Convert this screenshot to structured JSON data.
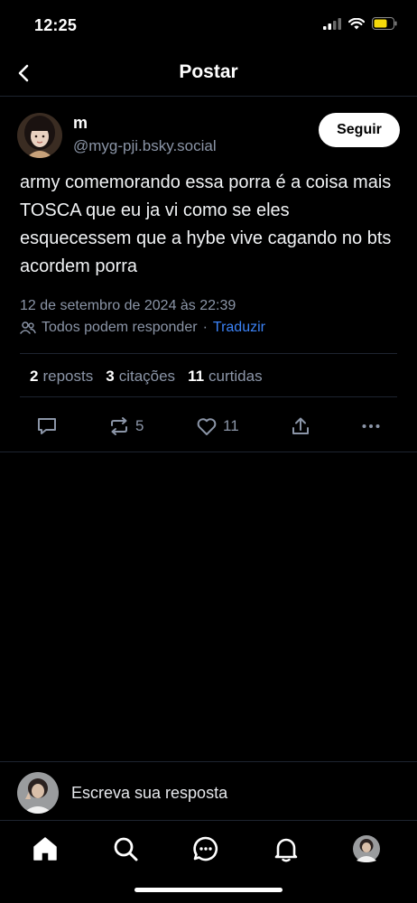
{
  "status_bar": {
    "time": "12:25",
    "icons": [
      "signal-icon",
      "wifi-icon",
      "battery-icon"
    ],
    "battery_color": "#f5d90a"
  },
  "header": {
    "title": "Postar",
    "back_icon": "chevron-left-icon"
  },
  "post": {
    "author_name": "m",
    "author_handle": "@myg-pji.bsky.social",
    "follow_label": "Seguir",
    "text": "army comemorando essa porra é a coisa mais TOSCA que eu ja vi como se eles esquecessem que a hybe vive cagando no bts acordem porra",
    "date": "12 de setembro de 2024 às 22:39",
    "reply_setting": "Todos podem responder",
    "separator": "·",
    "translate_label": "Traduzir"
  },
  "stats": {
    "reposts_count": "2",
    "reposts_label": "reposts",
    "quotes_count": "3",
    "quotes_label": "citações",
    "likes_count": "11",
    "likes_label": "curtidas"
  },
  "actions": {
    "reply_icon": "reply-icon",
    "repost_icon": "repost-icon",
    "repost_count": "5",
    "like_icon": "heart-icon",
    "like_count": "11",
    "share_icon": "share-icon",
    "more_icon": "more-icon"
  },
  "reply_bar": {
    "placeholder": "Escreva sua resposta"
  },
  "tab_bar": {
    "tabs": [
      "home-icon",
      "search-icon",
      "chat-icon",
      "bell-icon",
      "profile-avatar"
    ]
  },
  "colors": {
    "background": "#000000",
    "secondary_text": "#8b95a7",
    "link": "#3b82f6",
    "divider": "#1e2430"
  }
}
